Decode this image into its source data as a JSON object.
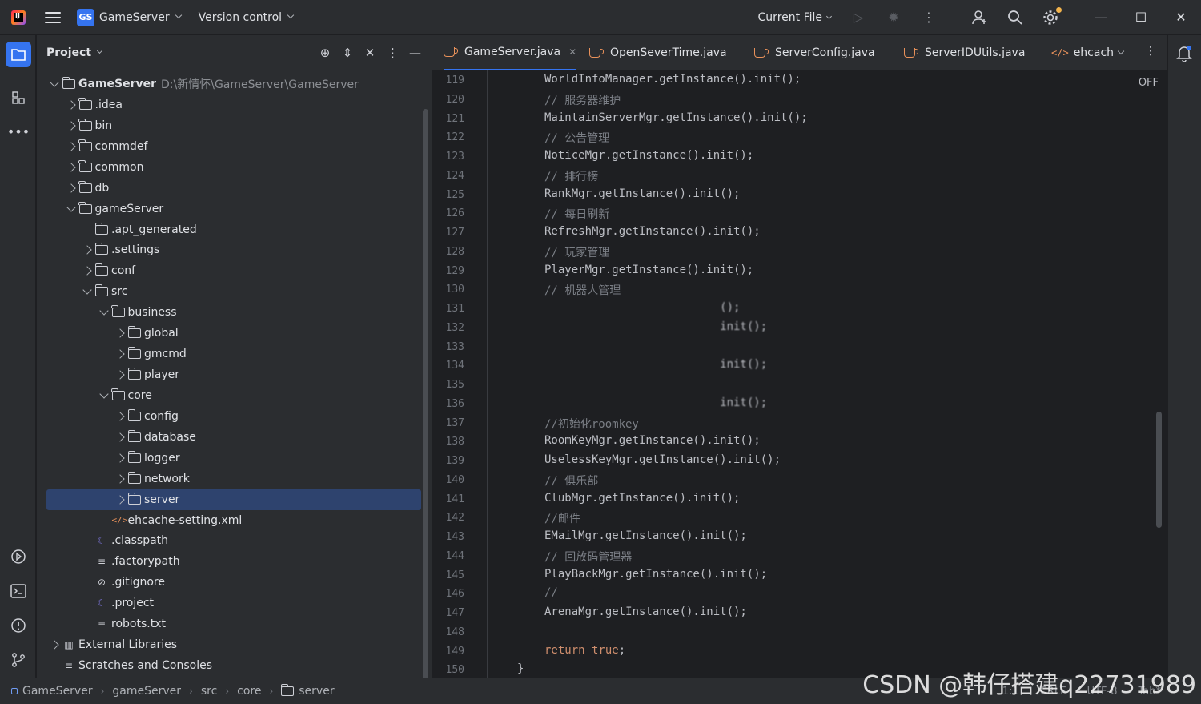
{
  "titlebar": {
    "project_badge": "GS",
    "project_name": "GameServer",
    "version_control": "Version control",
    "run_config": "Current File"
  },
  "project_panel": {
    "title": "Project",
    "tree": [
      {
        "label": "GameServer",
        "path": "D:\\新情怀\\GameServer\\GameServer",
        "icon": "module-folder",
        "arrow": "down",
        "indent": 0
      },
      {
        "label": ".idea",
        "icon": "folder",
        "arrow": "right",
        "indent": 1
      },
      {
        "label": "bin",
        "icon": "folder",
        "arrow": "right",
        "indent": 1
      },
      {
        "label": "commdef",
        "icon": "folder",
        "arrow": "right",
        "indent": 1
      },
      {
        "label": "common",
        "icon": "folder",
        "arrow": "right",
        "indent": 1
      },
      {
        "label": "db",
        "icon": "folder",
        "arrow": "right",
        "indent": 1
      },
      {
        "label": "gameServer",
        "icon": "folder",
        "arrow": "down",
        "indent": 1
      },
      {
        "label": ".apt_generated",
        "icon": "folder",
        "arrow": "none",
        "indent": 2
      },
      {
        "label": ".settings",
        "icon": "folder",
        "arrow": "right",
        "indent": 2
      },
      {
        "label": "conf",
        "icon": "folder",
        "arrow": "right",
        "indent": 2
      },
      {
        "label": "src",
        "icon": "folder",
        "arrow": "down",
        "indent": 2
      },
      {
        "label": "business",
        "icon": "folder",
        "arrow": "down",
        "indent": 3
      },
      {
        "label": "global",
        "icon": "folder",
        "arrow": "right",
        "indent": 4
      },
      {
        "label": "gmcmd",
        "icon": "folder",
        "arrow": "right",
        "indent": 4
      },
      {
        "label": "player",
        "icon": "folder",
        "arrow": "right",
        "indent": 4
      },
      {
        "label": "core",
        "icon": "folder",
        "arrow": "down",
        "indent": 3
      },
      {
        "label": "config",
        "icon": "folder",
        "arrow": "right",
        "indent": 4
      },
      {
        "label": "database",
        "icon": "folder",
        "arrow": "right",
        "indent": 4
      },
      {
        "label": "logger",
        "icon": "folder",
        "arrow": "right",
        "indent": 4
      },
      {
        "label": "network",
        "icon": "folder",
        "arrow": "right",
        "indent": 4
      },
      {
        "label": "server",
        "icon": "folder",
        "arrow": "right",
        "indent": 4,
        "selected": true
      },
      {
        "label": "ehcache-setting.xml",
        "icon": "xml",
        "arrow": "none",
        "indent": 3
      },
      {
        "label": ".classpath",
        "icon": "eclipse",
        "arrow": "none",
        "indent": 2
      },
      {
        "label": ".factorypath",
        "icon": "text",
        "arrow": "none",
        "indent": 2
      },
      {
        "label": ".gitignore",
        "icon": "ignore",
        "arrow": "none",
        "indent": 2
      },
      {
        "label": ".project",
        "icon": "eclipse",
        "arrow": "none",
        "indent": 2
      },
      {
        "label": "robots.txt",
        "icon": "text",
        "arrow": "none",
        "indent": 2
      },
      {
        "label": "External Libraries",
        "icon": "library",
        "arrow": "right",
        "indent": 0
      },
      {
        "label": "Scratches and Consoles",
        "icon": "scratch",
        "arrow": "none",
        "indent": 0
      }
    ]
  },
  "editor": {
    "tabs": [
      {
        "label": "GameServer.java",
        "icon": "java",
        "active": true,
        "closable": true
      },
      {
        "label": "OpenSeverTime.java",
        "icon": "java"
      },
      {
        "label": "ServerConfig.java",
        "icon": "java"
      },
      {
        "label": "ServerIDUtils.java",
        "icon": "java"
      },
      {
        "label": "ehcach",
        "icon": "xml"
      }
    ],
    "readonly_state": "OFF",
    "lines": [
      {
        "n": "119",
        "text": "WorldInfoManager.getInstance().init();",
        "kind": "code"
      },
      {
        "n": "120",
        "text": "// 服务器维护",
        "kind": "comment"
      },
      {
        "n": "121",
        "text": "MaintainServerMgr.getInstance().init();",
        "kind": "code"
      },
      {
        "n": "122",
        "text": "// 公告管理",
        "kind": "comment"
      },
      {
        "n": "123",
        "text": "NoticeMgr.getInstance().init();",
        "kind": "code"
      },
      {
        "n": "124",
        "text": "// 排行榜",
        "kind": "comment"
      },
      {
        "n": "125",
        "text": "RankMgr.getInstance().init();",
        "kind": "code"
      },
      {
        "n": "126",
        "text": "// 每日刷新",
        "kind": "comment"
      },
      {
        "n": "127",
        "text": "RefreshMgr.getInstance().init();",
        "kind": "code"
      },
      {
        "n": "128",
        "text": "// 玩家管理",
        "kind": "comment"
      },
      {
        "n": "129",
        "text": "PlayerMgr.getInstance().init();",
        "kind": "code"
      },
      {
        "n": "130",
        "text": "// 机器人管理",
        "kind": "comment"
      },
      {
        "n": "131",
        "text": "                          ();",
        "kind": "blur"
      },
      {
        "n": "132",
        "text": "                          init();",
        "kind": "blur"
      },
      {
        "n": "133",
        "text": "",
        "kind": "blur"
      },
      {
        "n": "134",
        "text": "                          init();",
        "kind": "blur"
      },
      {
        "n": "135",
        "text": "",
        "kind": "blur"
      },
      {
        "n": "136",
        "text": "                          init();",
        "kind": "blur"
      },
      {
        "n": "137",
        "text": "//初始化roomkey",
        "kind": "comment"
      },
      {
        "n": "138",
        "text": "RoomKeyMgr.getInstance().init();",
        "kind": "code"
      },
      {
        "n": "139",
        "text": "UselessKeyMgr.getInstance().init();",
        "kind": "code"
      },
      {
        "n": "140",
        "text": "// 俱乐部",
        "kind": "comment"
      },
      {
        "n": "141",
        "text": "ClubMgr.getInstance().init();",
        "kind": "code"
      },
      {
        "n": "142",
        "text": "//邮件",
        "kind": "comment"
      },
      {
        "n": "143",
        "text": "EMailMgr.getInstance().init();",
        "kind": "code"
      },
      {
        "n": "144",
        "text": "// 回放码管理器",
        "kind": "comment"
      },
      {
        "n": "145",
        "text": "PlayBackMgr.getInstance().init();",
        "kind": "code"
      },
      {
        "n": "146",
        "text": "//",
        "kind": "comment"
      },
      {
        "n": "147",
        "text": "ArenaMgr.getInstance().init();",
        "kind": "code"
      },
      {
        "n": "148",
        "text": "",
        "kind": "code"
      },
      {
        "n": "149",
        "text": "return true;",
        "kind": "keyword"
      },
      {
        "n": "150",
        "text": "}",
        "kind": "brace"
      }
    ]
  },
  "statusbar": {
    "breadcrumbs": [
      "GameServer",
      "gameServer",
      "src",
      "core",
      "server"
    ],
    "right": [
      "1:1",
      "CRLF",
      "UTF-8",
      "Tab*"
    ]
  },
  "watermark": "CSDN @韩仔搭建q22731989",
  "colors": {
    "accent": "#3574f0",
    "selection": "#2e436e",
    "keyword": "#cf8e6d",
    "comment": "#7a7e85"
  }
}
